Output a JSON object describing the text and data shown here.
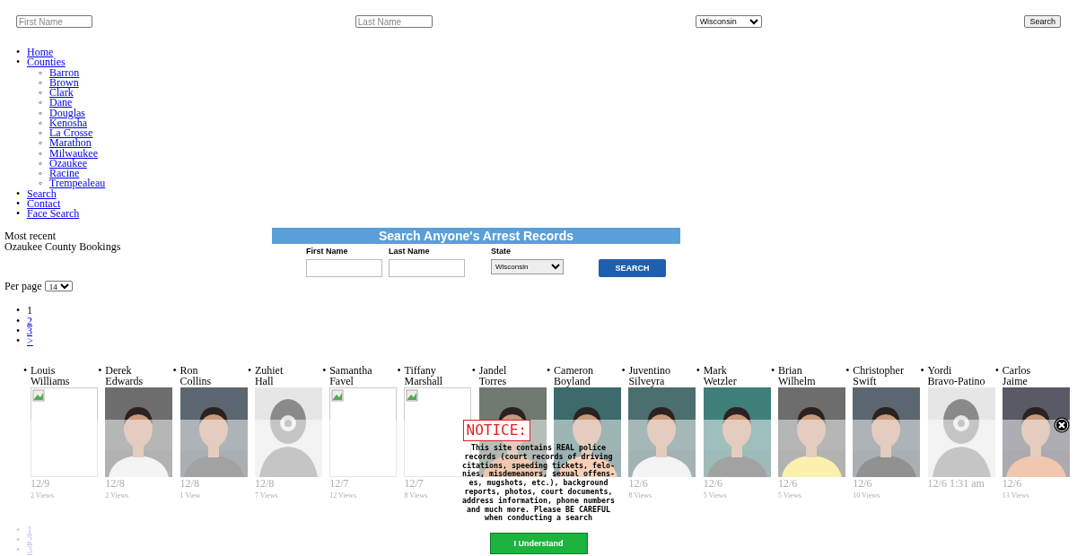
{
  "top_search": {
    "first_name_placeholder": "First Name",
    "last_name_placeholder": "Last Name",
    "state": "Wisconsin",
    "button": "Search"
  },
  "nav": [
    {
      "marker": "•",
      "label": "Home"
    },
    {
      "marker": "•",
      "label": "Counties",
      "children": [
        {
          "marker": "◦",
          "label": "Barron"
        },
        {
          "marker": "◦",
          "label": "Brown"
        },
        {
          "marker": "◦",
          "label": "Clark"
        },
        {
          "marker": "◦",
          "label": "Dane"
        },
        {
          "marker": "◦",
          "label": "Douglas"
        },
        {
          "marker": "◦",
          "label": "Kenosha"
        },
        {
          "marker": "◦",
          "label": "La Crosse"
        },
        {
          "marker": "◦",
          "label": "Marathon"
        },
        {
          "marker": "◦",
          "label": "Milwaukee"
        },
        {
          "marker": "◦",
          "label": "Ozaukee"
        },
        {
          "marker": "◦",
          "label": "Racine"
        },
        {
          "marker": "◦",
          "label": "Trempealeau"
        }
      ]
    },
    {
      "marker": "•",
      "label": "Search"
    },
    {
      "marker": "•",
      "label": "Contact"
    },
    {
      "marker": "•",
      "label": "Face Search"
    }
  ],
  "heading": [
    "Most recent",
    "Ozaukee County Bookings"
  ],
  "search_panel": {
    "title": "Search Anyone's Arrest Records",
    "first_name_label": "First Name",
    "last_name_label": "Last Name",
    "state_label": "State",
    "state": "Wisconsin",
    "button": "SEARCH"
  },
  "per_page": {
    "label": "Per page",
    "value": "14"
  },
  "pagination": [
    {
      "marker": "•",
      "label": "1",
      "selected": true
    },
    {
      "marker": "•",
      "label": "2",
      "selected": false
    },
    {
      "marker": "•",
      "label": "3",
      "selected": false
    },
    {
      "marker": "•",
      "label": ">",
      "selected": false
    }
  ],
  "bookings": [
    {
      "marker": "•",
      "first": "Louis",
      "last": "Williams",
      "kind": "broken",
      "date": "12/9",
      "views": "2 Views"
    },
    {
      "marker": "•",
      "first": "Derek",
      "last": "Edwards",
      "date": "12/8",
      "views": "2 Views"
    },
    {
      "marker": "•",
      "first": "Ron",
      "last": "Collins",
      "date": "12/8",
      "views": "1 View"
    },
    {
      "marker": "•",
      "first": "Zuhiet",
      "last": "Hall",
      "kind": "placeholder",
      "date": "12/8",
      "views": "7 Views"
    },
    {
      "marker": "•",
      "first": "Samantha",
      "last": "Favel",
      "kind": "broken",
      "date": "12/7",
      "views": "12 Views"
    },
    {
      "marker": "•",
      "first": "Tiffany",
      "last": "Marshall",
      "kind": "broken",
      "date": "12/7",
      "views": "8 Views"
    },
    {
      "marker": "•",
      "first": "Jandel",
      "last": "Torres"
    },
    {
      "marker": "•",
      "first": "Cameron",
      "last": "Boyland"
    },
    {
      "marker": "•",
      "first": "Juventino",
      "last": "Silveyra",
      "date": "12/6",
      "views": "8 Views"
    },
    {
      "marker": "•",
      "first": "Mark",
      "last": "Wetzler",
      "date": "12/6",
      "views": "5 Views"
    },
    {
      "marker": "•",
      "first": "Brian",
      "last": "Wilhelm",
      "date": "12/6",
      "views": "5 Views"
    },
    {
      "marker": "•",
      "first": "Christopher",
      "last": "Swift",
      "date": "12/6",
      "views": "10 Views"
    },
    {
      "marker": "•",
      "first": "Yordi",
      "last": "Bravo-Patino",
      "kind": "placeholder",
      "date": "12/6 1:31 am"
    },
    {
      "marker": "•",
      "first": "Carlos",
      "last": "Jaime",
      "date": "12/6",
      "views": "13 Views"
    }
  ],
  "bottom_pagination": [
    {
      "marker": "•",
      "label": "1"
    },
    {
      "marker": "•",
      "label": "2"
    },
    {
      "marker": "•",
      "label": "3"
    }
  ],
  "notice": {
    "title": "NOTICE:",
    "text": "This site contains REAL police records (court records of driving citations, speeding tickets, felo-nies, misdemeanors, sexual offens-es, mugshots, etc.), background reports, photos, court documents, address information, phone numbers and much more. Please BE CAREFUL when conducting a search",
    "button": "I Understand"
  }
}
